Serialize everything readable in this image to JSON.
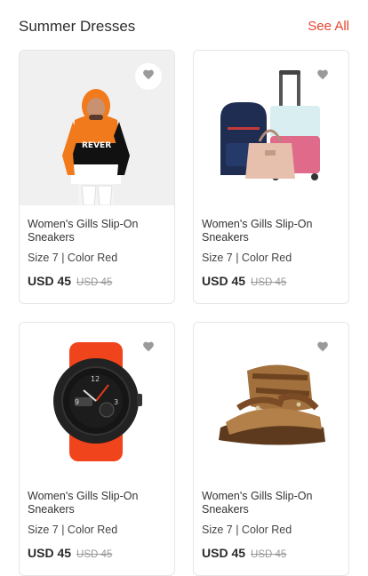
{
  "section": {
    "title": "Summer Dresses",
    "see_all": "See All"
  },
  "colors": {
    "accent": "#e8452c",
    "heart": "#9a9a9a"
  },
  "products": [
    {
      "image": "hoodie-man-photo",
      "name": "Women's Gills Slip-On Sneakers",
      "meta": "Size 7 | Color Red",
      "price": "USD 45",
      "old_price": "USD 45"
    },
    {
      "image": "luggage-set-photo",
      "name": "Women's Gills Slip-On Sneakers",
      "meta": "Size 7 | Color Red",
      "price": "USD 45",
      "old_price": "USD 45"
    },
    {
      "image": "sport-watch-photo",
      "name": "Women's Gills Slip-On Sneakers",
      "meta": "Size 7 | Color Red",
      "price": "USD 45",
      "old_price": "USD 45"
    },
    {
      "image": "sandals-photo",
      "name": "Women's Gills Slip-On Sneakers",
      "meta": "Size 7 | Color Red",
      "price": "USD 45",
      "old_price": "USD 45"
    }
  ]
}
